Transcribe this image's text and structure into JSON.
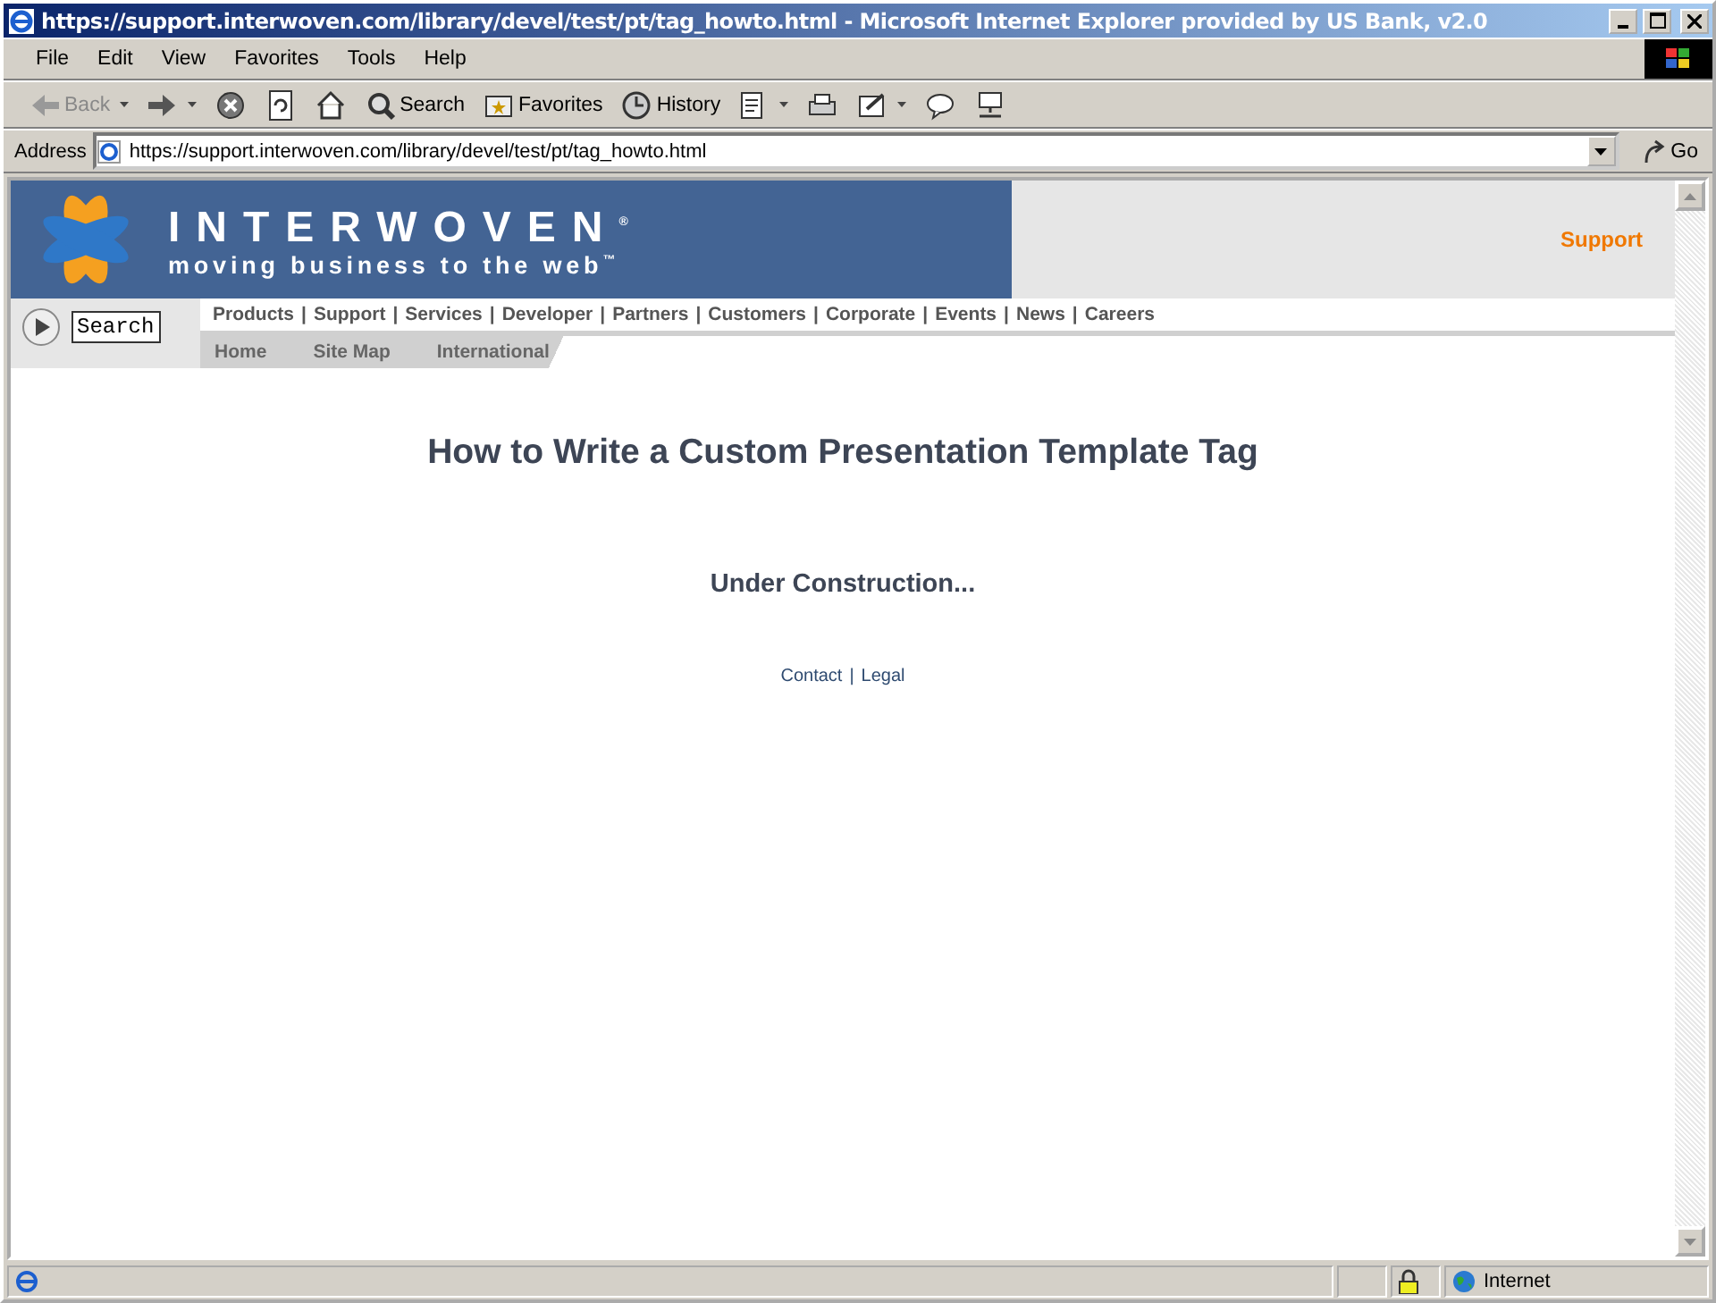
{
  "window": {
    "title": "https://support.interwoven.com/library/devel/test/pt/tag_howto.html - Microsoft Internet Explorer provided by US Bank, v2.0"
  },
  "menu": [
    "File",
    "Edit",
    "View",
    "Favorites",
    "Tools",
    "Help"
  ],
  "toolbar": [
    {
      "kind": "back",
      "label": "Back",
      "disabled": true
    },
    {
      "kind": "forward",
      "disabled": false
    },
    {
      "kind": "stop"
    },
    {
      "kind": "refresh"
    },
    {
      "kind": "home"
    },
    {
      "kind": "search",
      "label": "Search"
    },
    {
      "kind": "favorites",
      "label": "Favorites"
    },
    {
      "kind": "history",
      "label": "History"
    },
    {
      "kind": "mail"
    },
    {
      "kind": "print"
    },
    {
      "kind": "edit"
    },
    {
      "kind": "discuss"
    },
    {
      "kind": "messenger"
    }
  ],
  "address": {
    "label": "Address",
    "value": "https://support.interwoven.com/library/devel/test/pt/tag_howto.html",
    "go": "Go"
  },
  "page": {
    "logo": {
      "name": "INTERWOVEN",
      "reg": "®",
      "tagline": "moving business to the web",
      "tm": "™"
    },
    "section": "Support",
    "search": {
      "value": "Search"
    },
    "nav": [
      {
        "label": "Products",
        "sep": "|"
      },
      {
        "label": "Support",
        "sep": "|"
      },
      {
        "label": "Services",
        "sep": "|"
      },
      {
        "label": "Developer",
        "sep": "|"
      },
      {
        "label": "Partners",
        "sep": "|"
      },
      {
        "label": "Customers",
        "sep": "|"
      },
      {
        "label": "Corporate",
        "sep": "|"
      },
      {
        "label": "Events",
        "sep": "|"
      },
      {
        "label": "News",
        "sep": "|"
      },
      {
        "label": "Careers"
      }
    ],
    "subnav": [
      "Home",
      "Site Map",
      "International"
    ],
    "heading": "How to Write a Custom Presentation Template Tag",
    "notice": "Under Construction...",
    "footer": [
      {
        "label": "Contact",
        "sep": "|"
      },
      {
        "label": "Legal"
      }
    ]
  },
  "status_bar": {
    "zone": "Internet"
  }
}
